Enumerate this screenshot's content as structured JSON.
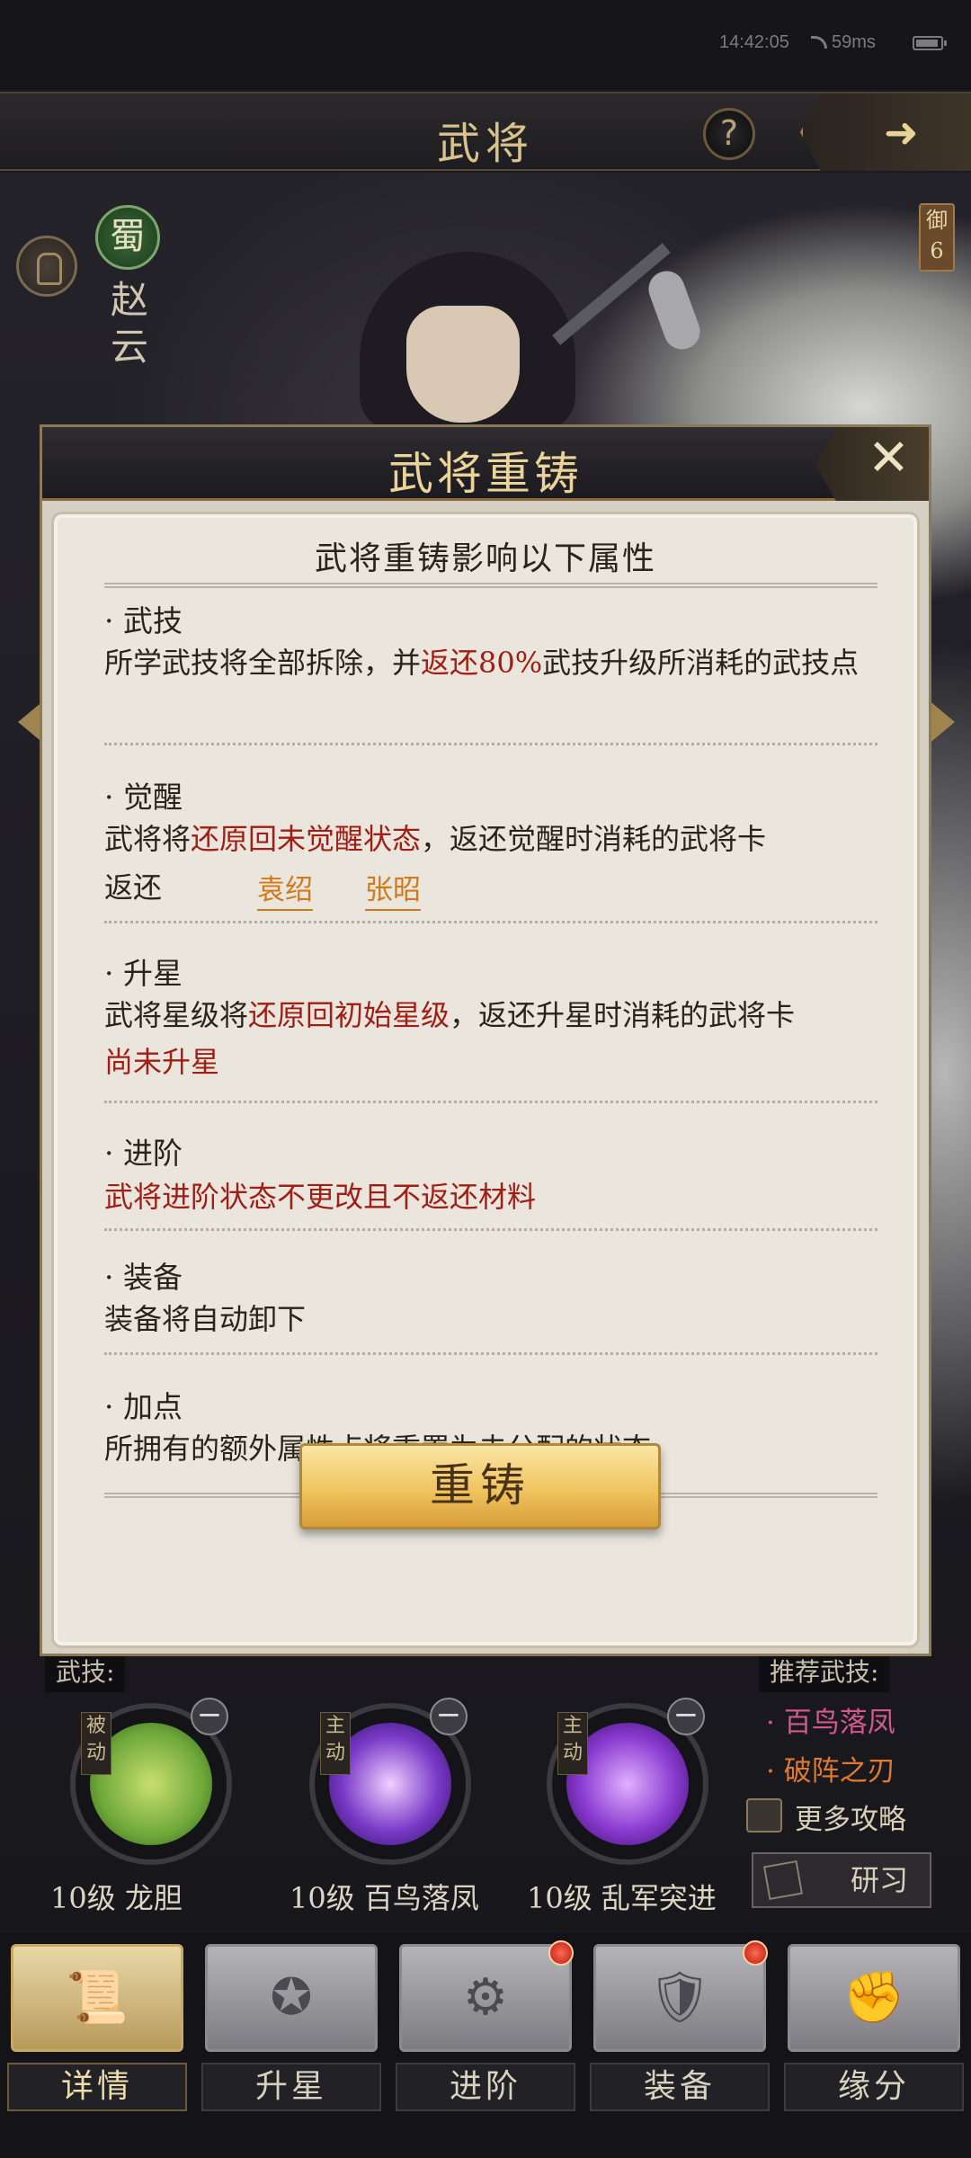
{
  "status_bar": {
    "time": "14:42:05",
    "ping": "59ms"
  },
  "header": {
    "title": "武将",
    "help_label": "?",
    "back_label": "➜"
  },
  "hero": {
    "faction": "蜀",
    "name": "赵云",
    "rank_tag": "御6"
  },
  "modal": {
    "title": "武将重铸",
    "close_label": "✕",
    "subtitle": "武将重铸影响以下属性",
    "sections": [
      {
        "head": "· 武技",
        "text_a": "所学武技将全部拆除，并",
        "text_red": "返还80%",
        "text_b": "武技升级所消耗的武技点"
      },
      {
        "head": "· 觉醒",
        "text_a": "武将将",
        "text_red": "还原回未觉醒状态",
        "text_b": "，返还觉醒时消耗的武将卡",
        "return_label": "返还",
        "links": [
          "袁绍",
          "张昭"
        ]
      },
      {
        "head": "· 升星",
        "text_a": "武将星级将",
        "text_red": "还原回初始星级",
        "text_b": "，返还升星时消耗的武将卡",
        "red_line": "尚未升星"
      },
      {
        "head": "· 进阶",
        "red_line": "武将进阶状态不更改且不返还材料"
      },
      {
        "head": "· 装备",
        "text": "装备将自动卸下"
      },
      {
        "head": "· 加点",
        "text": "所拥有的额外属性点将重置为未分配的状态"
      }
    ],
    "reforge_button": "重铸"
  },
  "skills": {
    "label": "武技:",
    "recommend_label": "推荐武技:",
    "items": [
      {
        "type": "被动",
        "name": "10级 龙胆",
        "color": "#6fa83a"
      },
      {
        "type": "主动",
        "name": "10级 百鸟落凤",
        "color": "#7a3ac8"
      },
      {
        "type": "主动",
        "name": "10级 乱军突进",
        "color": "#8a3ad0"
      }
    ],
    "recommend": [
      "· 百鸟落凤",
      "· 破阵之刃"
    ],
    "more_guide": "更多攻略",
    "study_button": "研习"
  },
  "bottom_nav": [
    {
      "label": "详情",
      "glyph": "📜",
      "active": true,
      "badge": false
    },
    {
      "label": "升星",
      "glyph": "✪",
      "active": false,
      "badge": false
    },
    {
      "label": "进阶",
      "glyph": "⚙",
      "active": false,
      "badge": true
    },
    {
      "label": "装备",
      "glyph": "🛡",
      "active": false,
      "badge": true
    },
    {
      "label": "缘分",
      "glyph": "✊",
      "active": false,
      "badge": false
    }
  ]
}
